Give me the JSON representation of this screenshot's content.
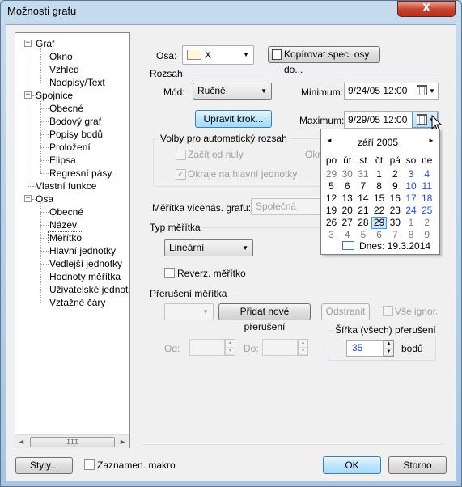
{
  "window": {
    "title": "Možnosti grafu",
    "close_glyph": "X"
  },
  "tree": {
    "items": [
      {
        "label": "Graf",
        "level": 0,
        "expander": "−"
      },
      {
        "label": "Okno",
        "level": 1
      },
      {
        "label": "Vzhled",
        "level": 1
      },
      {
        "label": "Nadpisy/Text",
        "level": 1
      },
      {
        "label": "Spojnice",
        "level": 0,
        "expander": "−"
      },
      {
        "label": "Obecné",
        "level": 1
      },
      {
        "label": "Bodový graf",
        "level": 1
      },
      {
        "label": "Popisy bodů",
        "level": 1
      },
      {
        "label": "Proložení",
        "level": 1
      },
      {
        "label": "Elipsa",
        "level": 1
      },
      {
        "label": "Regresní pásy",
        "level": 1
      },
      {
        "label": "Vlastní funkce",
        "level": 0
      },
      {
        "label": "Osa",
        "level": 0,
        "expander": "−"
      },
      {
        "label": "Obecné",
        "level": 1
      },
      {
        "label": "Název",
        "level": 1
      },
      {
        "label": "Měřítko",
        "level": 1,
        "selected": true
      },
      {
        "label": "Hlavní jednotky",
        "level": 1
      },
      {
        "label": "Vedlejší jednotky",
        "level": 1
      },
      {
        "label": "Hodnoty měřítka",
        "level": 1
      },
      {
        "label": "Uživatelské jednotky",
        "level": 1
      },
      {
        "label": "Vztažné čáry",
        "level": 1
      }
    ],
    "scroll_left_glyph": "◄",
    "scroll_right_glyph": "►",
    "scroll_thumb_grip": "III"
  },
  "axis": {
    "label": "Osa:",
    "value": "X",
    "copy_button": "Kopírovat spec. osy do..."
  },
  "range": {
    "section": "Rozsah",
    "mode_label": "Mód:",
    "mode_value": "Ručně",
    "min_label": "Minimum:",
    "min_value": "9/24/05 12:00",
    "max_label": "Maximum:",
    "max_value": "9/29/05 12:00",
    "edit_step_button": "Upravit krok...",
    "auto_group_label": "Volby pro automatický rozsah",
    "start_zero_label": "Začít od nuly",
    "edges_label": "Okraje na hlavní jednotky",
    "edges_partial": "Okra"
  },
  "multi_scale": {
    "label": "Měřítka vícenás. grafu:",
    "value": "Společná"
  },
  "scale_type": {
    "section": "Typ měřítka",
    "value": "Lineární",
    "reverse_label": "Reverz. měřítko"
  },
  "break": {
    "section": "Přerušení měřítka",
    "add_button": "Přidat nové přerušení",
    "remove_button": "Odstranit",
    "ignore_all_label": "Vše ignor.",
    "from_label": "Od:",
    "to_label": "Do:",
    "width_group_label": "Šířka (všech) přerušení",
    "width_value": "35",
    "width_unit": "bodů"
  },
  "calendar": {
    "month": "září 2005",
    "prev_glyph": "◄",
    "next_glyph": "►",
    "weekdays": [
      "po",
      "út",
      "st",
      "čt",
      "pá",
      "so",
      "ne"
    ],
    "weeks": [
      [
        "29",
        "30",
        "31",
        "1",
        "2",
        "3",
        "4"
      ],
      [
        "5",
        "6",
        "7",
        "8",
        "9",
        "10",
        "11"
      ],
      [
        "12",
        "13",
        "14",
        "15",
        "16",
        "17",
        "18"
      ],
      [
        "19",
        "20",
        "21",
        "22",
        "23",
        "24",
        "25"
      ],
      [
        "26",
        "27",
        "28",
        "29",
        "30",
        "1",
        "2"
      ],
      [
        "3",
        "4",
        "5",
        "6",
        "7",
        "8",
        "9"
      ]
    ],
    "today_label": "Dnes: 19.3.2014",
    "selected_day": "29"
  },
  "footer": {
    "styles_button": "Styly...",
    "record_macro_label": "Zaznamen. makro",
    "ok_button": "OK",
    "cancel_button": "Storno"
  },
  "colors": {
    "weekend_blue": "#2a4bd7",
    "other_month_gray": "#7a7a7a",
    "selection_blue": "#3399ff"
  },
  "icons": {
    "close": "close-icon",
    "calendar": "calendar-icon",
    "dropdown": "dropdown-arrow-icon",
    "copy": "copy-icon"
  }
}
